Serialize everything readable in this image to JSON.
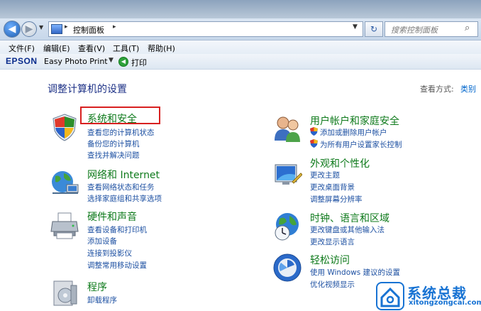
{
  "address": {
    "breadcrumb": "控制面板",
    "sep": "▸",
    "search_placeholder": "搜索控制面板"
  },
  "menu": {
    "file": "文件(F)",
    "edit": "编辑(E)",
    "view": "查看(V)",
    "tools": "工具(T)",
    "help": "帮助(H)"
  },
  "epson": {
    "logo": "EPSON",
    "app": "Easy Photo Print",
    "print": "打印"
  },
  "page": {
    "title": "调整计算机的设置",
    "view_by_label": "查看方式:",
    "view_by_value": "类别"
  },
  "categories": [
    {
      "title": "系统和安全",
      "links": [
        "查看您的计算机状态",
        "备份您的计算机",
        "查找并解决问题"
      ]
    },
    {
      "title": "网络和 Internet",
      "links": [
        "查看网络状态和任务",
        "选择家庭组和共享选项"
      ]
    },
    {
      "title": "硬件和声音",
      "links": [
        "查看设备和打印机",
        "添加设备",
        "连接到投影仪",
        "调整常用移动设置"
      ]
    },
    {
      "title": "程序",
      "links": [
        "卸载程序"
      ]
    },
    {
      "title": "用户帐户和家庭安全",
      "links": [
        "添加或删除用户帐户",
        "为所有用户设置家长控制"
      ]
    },
    {
      "title": "外观和个性化",
      "links": [
        "更改主题",
        "更改桌面背景",
        "调整屏幕分辨率"
      ]
    },
    {
      "title": "时钟、语言和区域",
      "links": [
        "更改键盘或其他输入法",
        "更改显示语言"
      ]
    },
    {
      "title": "轻松访问",
      "links": [
        "使用 Windows 建议的设置",
        "优化视频显示"
      ]
    }
  ],
  "watermark": {
    "name": "系统总裁",
    "url": "xitongzongcai.com"
  }
}
